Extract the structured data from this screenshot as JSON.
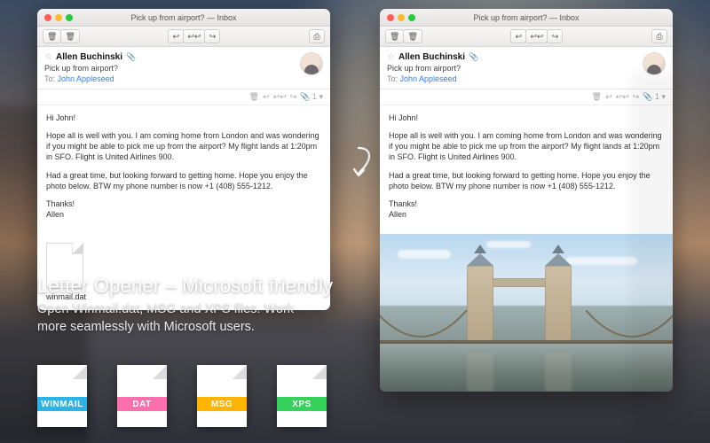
{
  "window_title": "Pick up from airport? — Inbox",
  "toolbar": {
    "trash": "🗑",
    "junk": "🗑",
    "reply": "↩",
    "reply_all": "↩↩",
    "forward": "↪",
    "print": "⎙"
  },
  "message": {
    "sender": "Allen Buchinski",
    "has_attachment_glyph": "📎",
    "subject": "Pick up from airport?",
    "to_label": "To:",
    "to_value": "John Appleseed",
    "actions": {
      "junk": "🗑",
      "reply": "↩",
      "reply_all": "↩↩",
      "forward": "↪",
      "attach": "📎 1 ▾"
    },
    "greeting": "Hi John!",
    "para1": "Hope all is well with you. I am coming home from London and was wondering if you might be able to pick me up from the airport? My flight lands at 1:20pm in SFO. Flight is United Airlines 900.",
    "para2": "Had a great time, but looking forward to getting home. Hope you enjoy the photo below. BTW my phone number is now +1 (408) 555-1212.",
    "signoff1": "Thanks!",
    "signoff2": "Allen",
    "attachment_name": "winmail.dat"
  },
  "marketing": {
    "headline": "Letter Opener – Microsoft friendly",
    "sub1": "Open Winmail.dat, MSG and XPS files. Work",
    "sub2": "more seamlessly with Microsoft users."
  },
  "badges": [
    {
      "label": "WINMAIL",
      "color": "#2bb3e6"
    },
    {
      "label": "DAT",
      "color": "#ff6fae"
    },
    {
      "label": "MSG",
      "color": "#ffb400"
    },
    {
      "label": "XPS",
      "color": "#34d15b"
    }
  ]
}
